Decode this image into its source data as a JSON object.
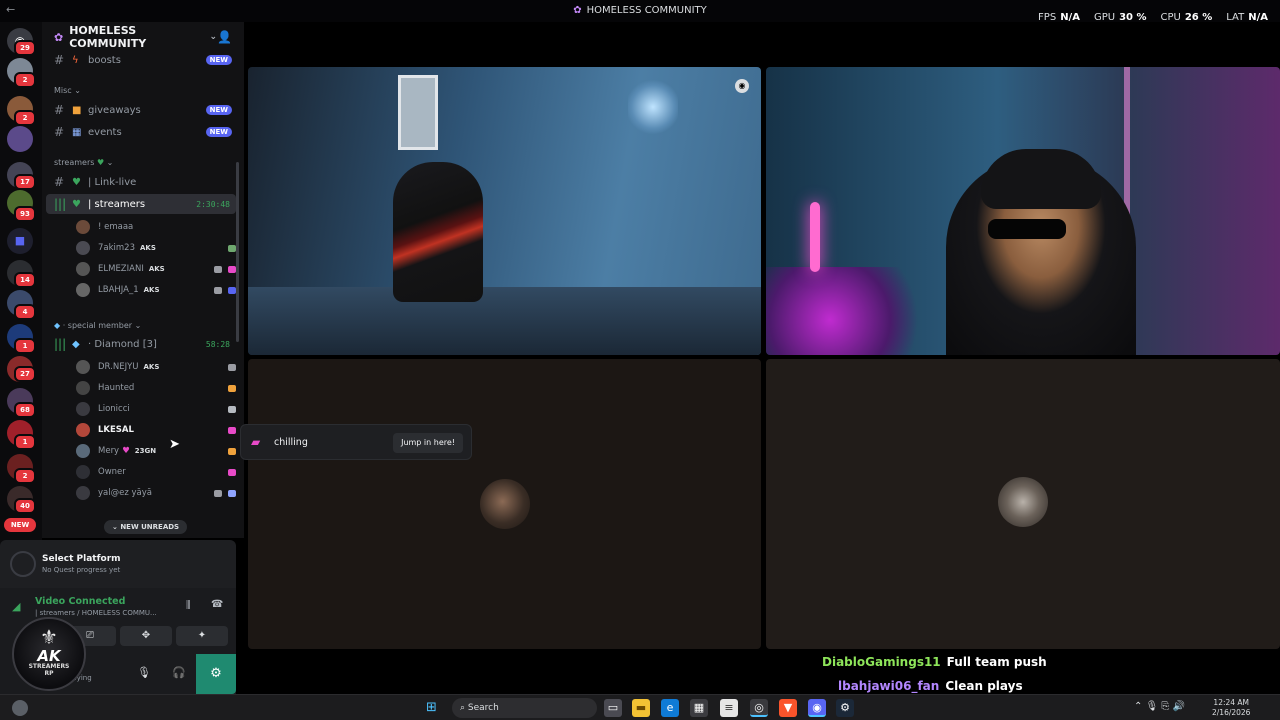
{
  "window": {
    "title": "HOMELESS COMMUNITY",
    "back_icon": "arrow-left-icon"
  },
  "stats": [
    {
      "label": "FPS",
      "value": "N/A"
    },
    {
      "label": "GPU",
      "value": "30 %"
    },
    {
      "label": "CPU",
      "value": "26 %"
    },
    {
      "label": "LAT",
      "value": "N/A"
    }
  ],
  "server_rail": {
    "badges": [
      "29",
      "2",
      "2",
      "17",
      "93",
      "14",
      "4",
      "1",
      "27",
      "68",
      "1",
      "2",
      "40"
    ],
    "new_label": "NEW"
  },
  "server": {
    "name": "HOMELESS COMMUNITY"
  },
  "channels": {
    "boosts": "boosts",
    "misc_category": "Misc",
    "giveaways": "giveaways",
    "events": "events",
    "new_badge": "NEW",
    "streamers_category": "streamers",
    "link_live": "| Link-live",
    "streamers_voice": "| streamers",
    "streamers_timer": "2:30:48",
    "special_category": "special member",
    "diamond_voice": "· Diamond [3]",
    "diamond_timer": "58:28",
    "new_unreads": "NEW UNREADS"
  },
  "streamers_members": [
    {
      "name": "! emaaa",
      "tag": ""
    },
    {
      "name": "7akim23",
      "tag": "AKS"
    },
    {
      "name": "ELMEZIANI",
      "tag": "AKS"
    },
    {
      "name": "LBAHJA_1",
      "tag": "AKS"
    }
  ],
  "diamond_members": [
    {
      "name": "DR.NEJYU",
      "tag": "AKS"
    },
    {
      "name": "Haunted",
      "tag": ""
    },
    {
      "name": "Lionicci",
      "tag": ""
    },
    {
      "name": "LKESAL",
      "tag": ""
    },
    {
      "name": "Mery",
      "tag": "23GN"
    },
    {
      "name": "Owner",
      "tag": ""
    },
    {
      "name": "yal@ez yāyā",
      "tag": ""
    }
  ],
  "quest": {
    "title": "Select Platform",
    "subtitle": "No Quest progress yet"
  },
  "voice": {
    "status": "Video Connected",
    "location": "| streamers / HOMELESS COMMU...",
    "user_status": "...ying"
  },
  "logo": {
    "text": "AK",
    "sub": "STREAMERS",
    "sub2": "RP"
  },
  "popup": {
    "activity": "chilling",
    "button": "Jump in here!"
  },
  "chat": [
    {
      "user": "DiabloGamings11",
      "message": "Full team push"
    },
    {
      "user": "lbahjawi06_fan",
      "message": "Clean plays"
    }
  ],
  "taskbar": {
    "search_placeholder": "Search",
    "time": "12:24 AM",
    "date": "2/16/2026"
  },
  "colors": {
    "accent_green": "#3ba55d",
    "new_red": "#e5363d",
    "blurple": "#5865f2",
    "chat_user1": "#8ee55a",
    "chat_user2": "#b387ff"
  }
}
